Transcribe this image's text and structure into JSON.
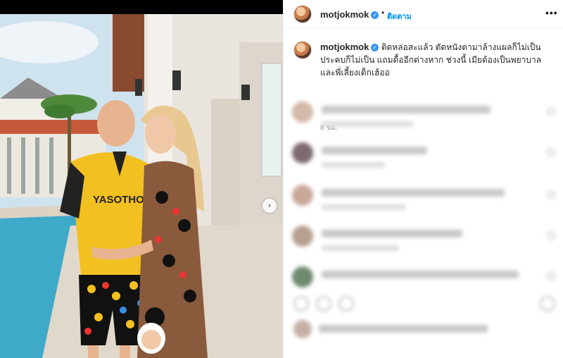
{
  "post": {
    "username": "motjokmok",
    "follow_label": "ติดตาม",
    "dot": "•",
    "more_label": "•••",
    "verified_glyph": "✓",
    "caption": "ติดหล่อสะแล้ว ตัดหนังตามาล้างแผลก็ไม่เป็น ประคบก็ไม่เป็น แถมดื้ออีกต่างหาก ช่วงนี้ เมียต้องเป็นพยาบาล และพี่เลี้ยงเด็กเฮ้ออ",
    "time": "8 ชม.",
    "next_glyph": "›"
  },
  "photo": {
    "shirt_text": "YASOTHON",
    "colors": {
      "sky": "#cfe3ef",
      "pool": "#3fa9c9",
      "shirt": "#f2c020",
      "dress": "#8a5a3c",
      "wall": "#e9e5de"
    }
  },
  "comments_blurred": [
    {
      "avatar_color": "#d4b8a8"
    },
    {
      "avatar_color": "#7d6a72"
    },
    {
      "avatar_color": "#c9a89a"
    },
    {
      "avatar_color": "#b8a090"
    },
    {
      "avatar_color": "#6f8a6e"
    }
  ]
}
